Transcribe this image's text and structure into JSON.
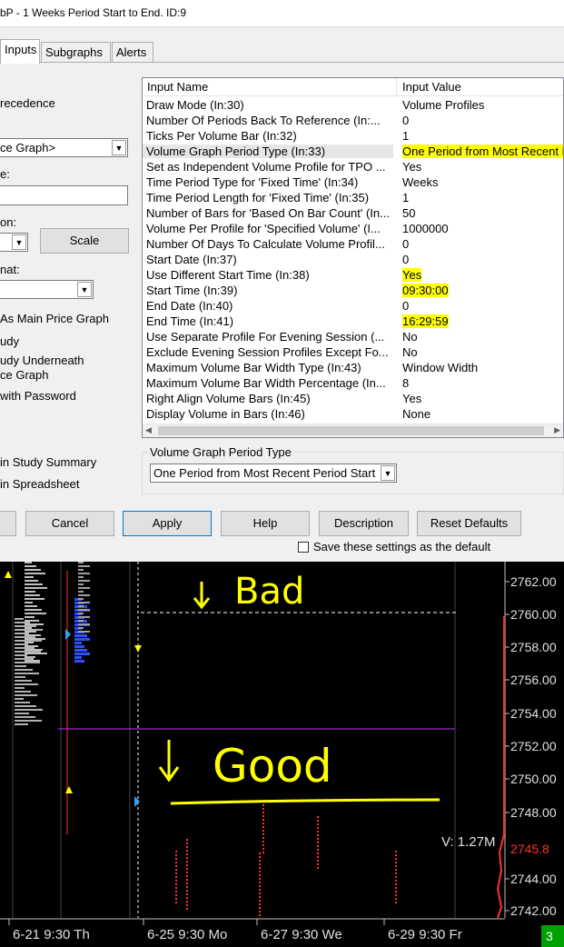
{
  "window": {
    "title": "bP - 1 Weeks Period Start to End. ID:9"
  },
  "tabs": [
    {
      "label": "Inputs",
      "active": true
    },
    {
      "label": "Subgraphs",
      "active": false
    },
    {
      "label": "Alerts",
      "active": false
    }
  ],
  "left_panel": {
    "precedence_label": "recedence",
    "graph_combo_value": "ce Graph>",
    "name_label": "e:",
    "region_label": "on:",
    "scale_button": "Scale",
    "format_label": "nat:",
    "as_main_price_graph": "As Main Price Graph",
    "study_label": "udy",
    "study_underneath_line1": "udy Underneath",
    "study_underneath_line2": "ce Graph",
    "with_password": "with Password",
    "in_study_summary": "in Study Summary",
    "in_spreadsheet": "in Spreadsheet"
  },
  "grid": {
    "headers": {
      "name": "Input Name",
      "value": "Input Value"
    },
    "rows": [
      {
        "name": "Draw Mode   (In:30)",
        "value": "Volume Profiles"
      },
      {
        "name": "Number Of Periods Back To Reference   (In:...",
        "value": "0"
      },
      {
        "name": "Ticks Per Volume Bar   (In:32)",
        "value": "1"
      },
      {
        "name": "Volume Graph Period Type   (In:33)",
        "value": "One Period from Most Recent Period Start",
        "selected": true,
        "highlight": true
      },
      {
        "name": "Set as Independent Volume Profile for TPO ...",
        "value": "Yes"
      },
      {
        "name": "Time Period Type for 'Fixed Time'   (In:34)",
        "value": "Weeks"
      },
      {
        "name": "Time Period Length for 'Fixed Time'   (In:35)",
        "value": "1"
      },
      {
        "name": "Number of Bars for 'Based On Bar Count'   (In...",
        "value": "50"
      },
      {
        "name": "Volume Per Profile for 'Specified Volume'   (I...",
        "value": "1000000"
      },
      {
        "name": "Number Of Days To Calculate Volume Profil...",
        "value": "0"
      },
      {
        "name": "Start Date   (In:37)",
        "value": "0"
      },
      {
        "name": "Use Different Start Time   (In:38)",
        "value": "Yes",
        "highlight": true
      },
      {
        "name": "Start Time   (In:39)",
        "value": "09:30:00",
        "highlight": true
      },
      {
        "name": "End Date   (In:40)",
        "value": "0"
      },
      {
        "name": "End Time   (In:41)",
        "value": "16:29:59",
        "highlight": true
      },
      {
        "name": "Use Separate Profile For Evening Session   (...",
        "value": "No"
      },
      {
        "name": "Exclude Evening Session Profiles Except Fo...",
        "value": "No"
      },
      {
        "name": "Maximum Volume Bar Width Type   (In:43)",
        "value": "Window Width"
      },
      {
        "name": "Maximum Volume Bar Width Percentage   (In...",
        "value": "8"
      },
      {
        "name": "Right Align Volume Bars   (In:45)",
        "value": "Yes"
      },
      {
        "name": "Display Volume in Bars   (In:46)",
        "value": "None"
      }
    ]
  },
  "groupbox": {
    "title": "Volume Graph Period Type",
    "selected": "One Period from Most Recent Period Start"
  },
  "buttons": {
    "ok": "",
    "cancel": "Cancel",
    "apply": "Apply",
    "help": "Help",
    "description": "Description",
    "reset_defaults": "Reset Defaults"
  },
  "save_default_label": "Save these settings as the default",
  "chart": {
    "annotations": {
      "bad": "Bad",
      "good": "Good"
    },
    "price_labels": [
      "2762.00",
      "2760.00",
      "2758.00",
      "2756.00",
      "2754.00",
      "2752.00",
      "2750.00",
      "2748.00",
      "2744.00",
      "2742.00"
    ],
    "current_price": "2745.8",
    "volume_label": "V: 1.27M",
    "time_labels": [
      "6-21  9:30 Th",
      "6-25  9:30 Mo",
      "6-27  9:30 We",
      "6-29  9:30 Fr"
    ],
    "bottom_badge": "3",
    "colors": {
      "background": "#000000",
      "annotation": "#ffff00",
      "price_up": "#ff3030",
      "volume_blue": "#3050ff"
    }
  }
}
